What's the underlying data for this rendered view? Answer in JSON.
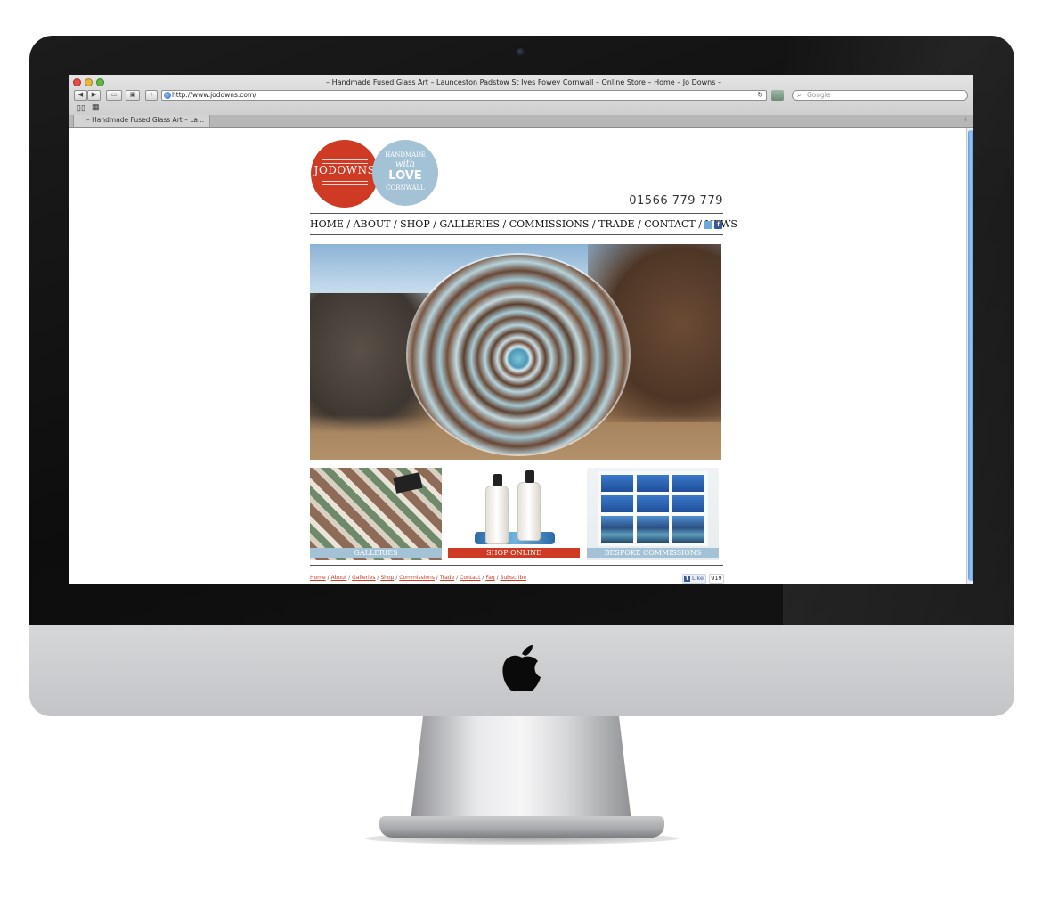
{
  "browser": {
    "window_title": "– Handmade Fused Glass Art – Launceston Padstow St Ives Fowey Cornwall – Online Store – Home – Jo Downs –",
    "url": "http://www.jodowns.com/",
    "search_placeholder": "Google",
    "tab_title": "– Handmade Fused Glass Art – La...",
    "icons": [
      "back-icon",
      "forward-icon",
      "bookmark-add-icon",
      "history-icon",
      "new-tab-icon",
      "globe-icon",
      "reload-icon",
      "rss-icon",
      "search-icon",
      "bookmarks-book-icon",
      "top-sites-grid-icon"
    ]
  },
  "site": {
    "logo": {
      "brand": "JODOWNS",
      "badge_line1": "HANDMADE",
      "badge_line2": "with",
      "badge_line3": "LOVE",
      "badge_line4": "CORNWALL"
    },
    "phone": "01566 779 779",
    "nav": [
      "HOME",
      "ABOUT",
      "SHOP",
      "GALLERIES",
      "COMMISSIONS",
      "TRADE",
      "CONTACT",
      "NEWS"
    ],
    "nav_separator": " / ",
    "social_icons": [
      "twitter-icon",
      "facebook-icon"
    ],
    "tiles": [
      {
        "label": "GALLERIES"
      },
      {
        "label": "SHOP ONLINE"
      },
      {
        "label": "BESPOKE COMMISSIONS"
      }
    ],
    "footer_links": [
      "Home",
      "About",
      "Galleries",
      "Shop",
      "Commissions",
      "Trade",
      "Contact",
      "Faq",
      "Subscribe"
    ],
    "like": {
      "label": "Like",
      "count": "919"
    }
  },
  "colors": {
    "brand_red": "#cf3a24",
    "brand_blue": "#a4c2d6",
    "facebook": "#3b5998"
  }
}
